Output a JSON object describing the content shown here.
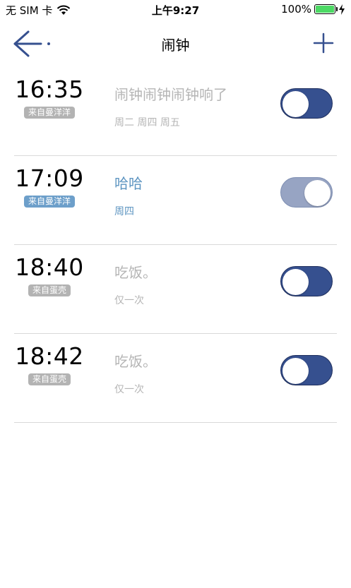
{
  "status_bar": {
    "carrier": "无 SIM 卡",
    "time": "上午9:27",
    "battery": "100%"
  },
  "nav": {
    "title": "闹钟"
  },
  "colors": {
    "accent_blue": "#36508f",
    "toggle_light": "#97a4c3",
    "source_gray": "#b3b3b3",
    "source_blue": "#6d9fca",
    "label_gray": "#b5b5b5",
    "label_blue": "#5e95c1"
  },
  "alarms": [
    {
      "time": "16:35",
      "source": "来自曼洋洋",
      "label": "闹钟闹钟闹钟响了",
      "days": "周二 周四 周五",
      "toggle_style": "dark",
      "highlight": false
    },
    {
      "time": "17:09",
      "source": "来自曼洋洋",
      "label": "哈哈",
      "days": "周四",
      "toggle_style": "light",
      "highlight": true
    },
    {
      "time": "18:40",
      "source": "来自蛋壳",
      "label": "吃饭。",
      "days": "仅一次",
      "toggle_style": "dark",
      "highlight": false
    },
    {
      "time": "18:42",
      "source": "来自蛋壳",
      "label": "吃饭。",
      "days": "仅一次",
      "toggle_style": "dark",
      "highlight": false
    }
  ]
}
